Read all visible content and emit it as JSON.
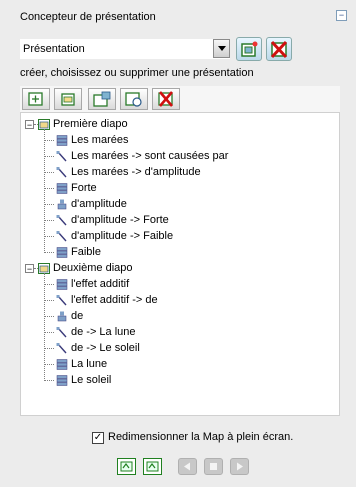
{
  "header": {
    "title": "Concepteur de présentation",
    "collapse": "−"
  },
  "presentation": {
    "selected": "Présentation",
    "hint": "créer, choisissez ou supprimer une présentation"
  },
  "tree": {
    "slides": [
      {
        "label": "Première diapo",
        "expander": "−",
        "items": [
          {
            "label": "Les marées",
            "type": "node"
          },
          {
            "label": "Les marées -> sont causées par",
            "type": "link"
          },
          {
            "label": "Les marées -> d'amplitude",
            "type": "link"
          },
          {
            "label": "Forte",
            "type": "node"
          },
          {
            "label": "d'amplitude",
            "type": "linkphrase"
          },
          {
            "label": "d'amplitude -> Forte",
            "type": "link"
          },
          {
            "label": "d'amplitude -> Faible",
            "type": "link"
          },
          {
            "label": "Faible",
            "type": "node"
          }
        ]
      },
      {
        "label": "Deuxième diapo",
        "expander": "−",
        "items": [
          {
            "label": "l'effet additif",
            "type": "node"
          },
          {
            "label": "l'effet additif -> de",
            "type": "link"
          },
          {
            "label": "de",
            "type": "linkphrase"
          },
          {
            "label": "de -> La lune",
            "type": "link"
          },
          {
            "label": "de -> Le soleil",
            "type": "link"
          },
          {
            "label": "La lune",
            "type": "node"
          },
          {
            "label": "Le soleil",
            "type": "node"
          }
        ]
      }
    ]
  },
  "footer": {
    "checkbox_label": "Redimensionner la Map à plein écran.",
    "checked": true,
    "check_mark": "✓"
  },
  "colors": {
    "accent": "#2a7a2a",
    "danger": "#d01010",
    "link_icon": "#3a3a7a"
  }
}
